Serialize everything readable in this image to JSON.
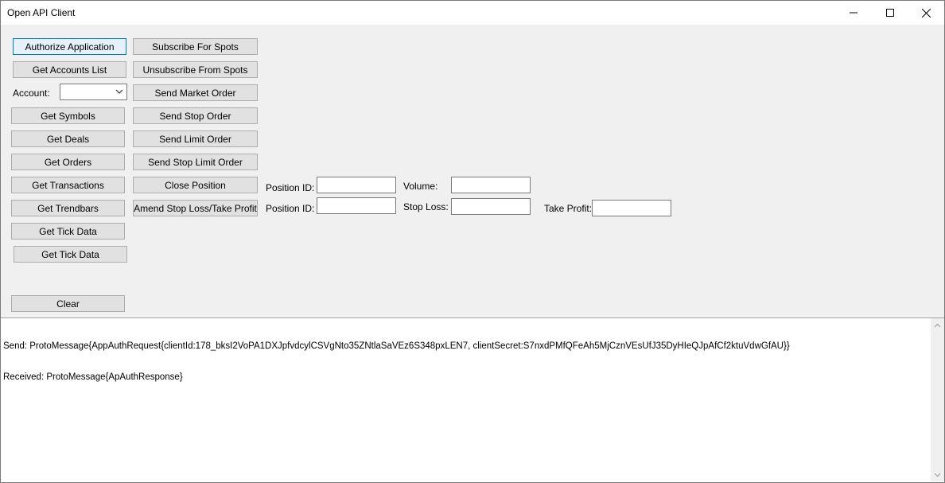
{
  "window": {
    "title": "Open API Client",
    "minimize_icon": "minimize-icon",
    "maximize_icon": "maximize-icon",
    "close_icon": "close-icon"
  },
  "left_buttons": {
    "authorize": "Authorize Application",
    "accounts": "Get Accounts List",
    "symbols": "Get Symbols",
    "deals": "Get Deals",
    "orders": "Get Orders",
    "transactions": "Get Transactions",
    "trendbars": "Get Trendbars",
    "tick1": "Get Tick Data",
    "tick2": "Get Tick Data",
    "clear": "Clear"
  },
  "account": {
    "label": "Account:",
    "value": ""
  },
  "right_buttons": {
    "subscribe": "Subscribe For Spots",
    "unsubscribe": "Unsubscribe From Spots",
    "market": "Send Market Order",
    "stop": "Send Stop Order",
    "limit": "Send Limit Order",
    "stop_limit": "Send Stop Limit Order",
    "close_position": "Close Position",
    "amend": "Amend Stop Loss/Take Profit"
  },
  "close_form": {
    "position_label": "Position ID:",
    "position_value": "",
    "volume_label": "Volume:",
    "volume_value": ""
  },
  "amend_form": {
    "position_label": "Position ID:",
    "position_value": "",
    "stop_loss_label": "Stop Loss:",
    "stop_loss_value": "",
    "take_profit_label": "Take Profit:",
    "take_profit_value": ""
  },
  "log": {
    "lines": [
      "Send: ProtoMessage{AppAuthRequest{clientId:178_bksI2VoPA1DXJpfvdcylCSVgNto35ZNtlaSaVEz6S348pxLEN7, clientSecret:S7nxdPMfQFeAh5MjCznVEsUfJ35DyHIeQJpAfCf2ktuVdwGfAU}}",
      "Received: ProtoMessage{ApAuthResponse}"
    ]
  }
}
